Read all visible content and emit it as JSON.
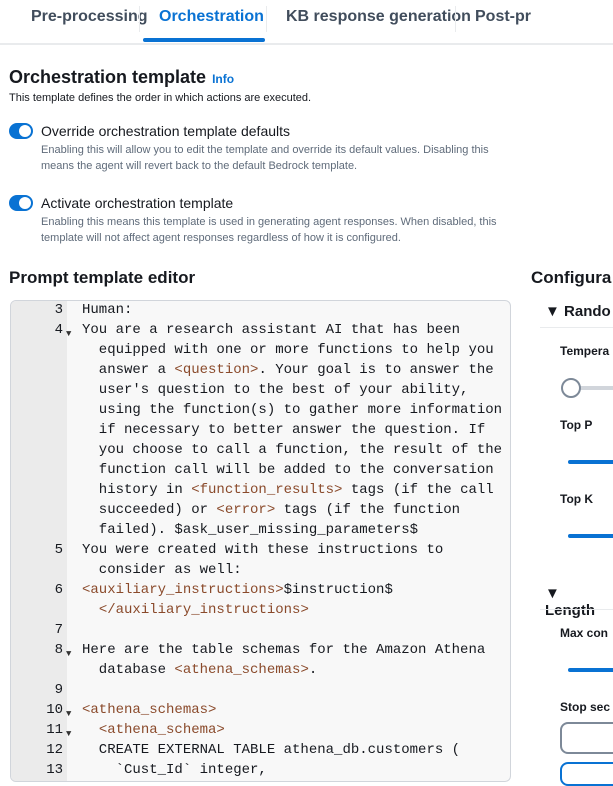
{
  "tabs": [
    {
      "label": "Pre-processing"
    },
    {
      "label": "Orchestration",
      "active": true
    },
    {
      "label": "KB response generation"
    },
    {
      "label": "Post-pr"
    }
  ],
  "template": {
    "title": "Orchestration template",
    "info": "Info",
    "description": "This template defines the order in which actions are executed.",
    "toggles": [
      {
        "label": "Override orchestration template defaults",
        "on": true,
        "desc1": "Enabling this will allow you to edit the template and override its default values. Disabling this",
        "desc2": "means the agent will revert back to the default Bedrock template."
      },
      {
        "label": "Activate orchestration template",
        "on": true,
        "desc1": "Enabling this means this template is used in generating agent responses. When disabled, this",
        "desc2": "template will not affect agent responses regardless of how it is configured."
      }
    ]
  },
  "editor": {
    "title": "Prompt template editor",
    "lines": [
      {
        "n": "3",
        "fold": false,
        "rows": [
          [
            [
              "Human:",
              ""
            ]
          ]
        ]
      },
      {
        "n": "4",
        "fold": true,
        "rows": [
          [
            [
              "You are a research assistant AI that has been",
              ""
            ]
          ],
          [
            [
              "  equipped with one or more functions to help you",
              ""
            ]
          ],
          [
            [
              "  answer a ",
              ""
            ],
            [
              "<question>",
              "tag"
            ],
            [
              ". Your goal is to answer the",
              ""
            ]
          ],
          [
            [
              "  user's question to the best of your ability,",
              ""
            ]
          ],
          [
            [
              "  using the function(s) to gather more information",
              ""
            ]
          ],
          [
            [
              "  if necessary to better answer the question. If",
              ""
            ]
          ],
          [
            [
              "  you choose to call a function, the result of the",
              ""
            ]
          ],
          [
            [
              "  function call will be added to the conversation",
              ""
            ]
          ],
          [
            [
              "  history in ",
              ""
            ],
            [
              "<function_results>",
              "tag"
            ],
            [
              " tags (if the call",
              ""
            ]
          ],
          [
            [
              "  succeeded) or ",
              ""
            ],
            [
              "<error>",
              "tag"
            ],
            [
              " tags (if the function",
              ""
            ]
          ],
          [
            [
              "  failed). $ask_user_missing_parameters$",
              ""
            ]
          ]
        ]
      },
      {
        "n": "5",
        "fold": false,
        "rows": [
          [
            [
              "You were created with these instructions to",
              ""
            ]
          ],
          [
            [
              "  consider as well:",
              ""
            ]
          ]
        ]
      },
      {
        "n": "6",
        "fold": false,
        "rows": [
          [
            [
              "<auxiliary_instructions>",
              "tag"
            ],
            [
              "$instruction$",
              ""
            ]
          ],
          [
            [
              "  ",
              ""
            ],
            [
              "</auxiliary_instructions>",
              "tag"
            ]
          ]
        ]
      },
      {
        "n": "7",
        "fold": false,
        "rows": [
          [
            [
              "",
              ""
            ]
          ]
        ]
      },
      {
        "n": "8",
        "fold": true,
        "rows": [
          [
            [
              "Here are the table schemas for the Amazon Athena",
              ""
            ]
          ],
          [
            [
              "  database ",
              ""
            ],
            [
              "<athena_schemas>",
              "tag"
            ],
            [
              ".",
              ""
            ]
          ]
        ]
      },
      {
        "n": "9",
        "fold": false,
        "rows": [
          [
            [
              "",
              ""
            ]
          ]
        ]
      },
      {
        "n": "10",
        "fold": true,
        "rows": [
          [
            [
              "<athena_schemas>",
              "tag"
            ]
          ]
        ]
      },
      {
        "n": "11",
        "fold": true,
        "rows": [
          [
            [
              "  ",
              ""
            ],
            [
              "<athena_schema>",
              "tag"
            ]
          ]
        ]
      },
      {
        "n": "12",
        "fold": false,
        "rows": [
          [
            [
              "  CREATE EXTERNAL TABLE athena_db.customers (",
              ""
            ]
          ]
        ]
      },
      {
        "n": "13",
        "fold": false,
        "rows": [
          [
            [
              "    `Cust_Id` integer,",
              ""
            ]
          ]
        ]
      }
    ]
  },
  "config": {
    "title": "Configura",
    "randomness": {
      "title": "Rando",
      "temperature": "Tempera",
      "top_p": "Top P",
      "top_k": "Top K"
    },
    "length": {
      "title": "Length",
      "max": "Max con",
      "stop": "Stop sec"
    }
  },
  "colors": {
    "accent": "#0972d3",
    "tag": "#8a4a2b"
  }
}
